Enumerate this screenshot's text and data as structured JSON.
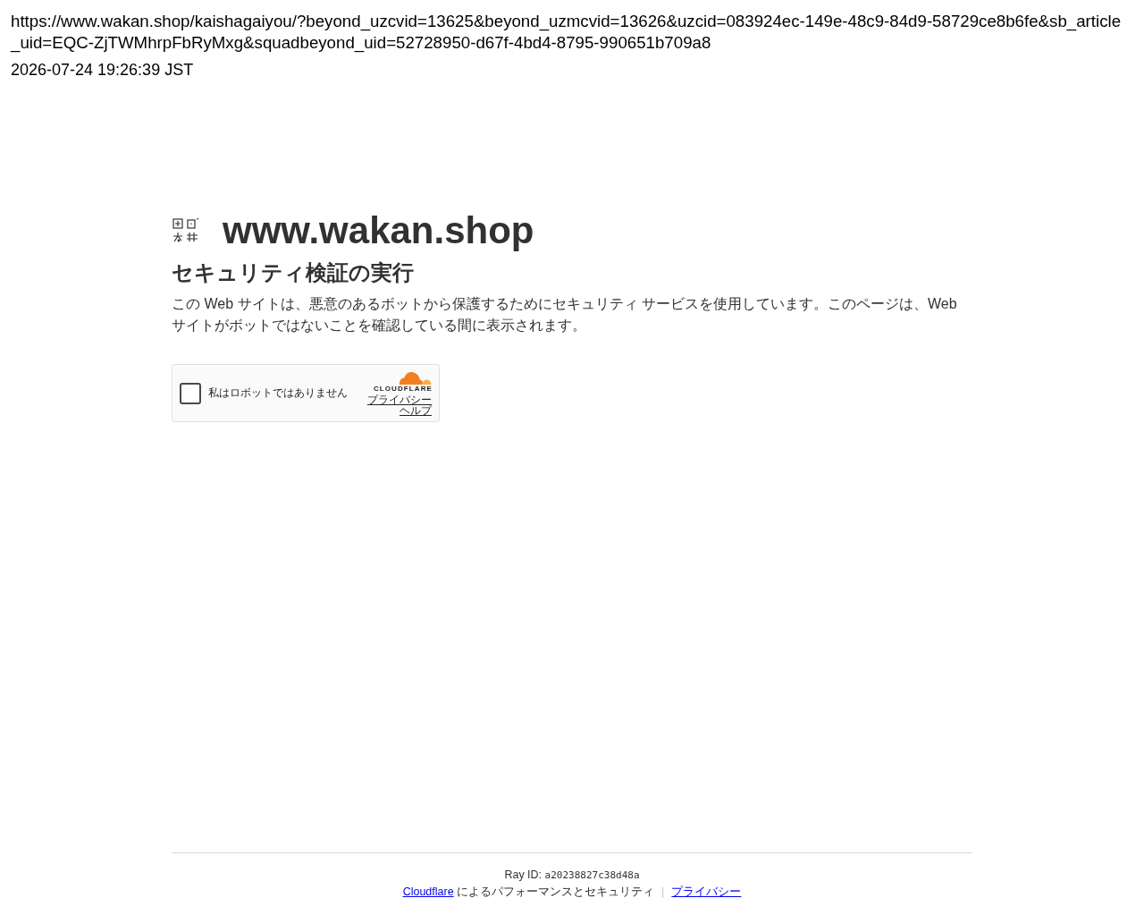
{
  "header": {
    "url": "https://www.wakan.shop/kaishagaiyou/?beyond_uzcvid=13625&beyond_uzmcvid=13626&uzcid=083924ec-149e-48c9-84d9-58729ce8b6fe&sb_article_uid=EQC-ZjTWMhrpFbRyMxg&squadbeyond_uid=52728950-d67f-4bd4-8795-990651b709a8",
    "timestamp": "2026-07-24 19:26:39 JST"
  },
  "site": {
    "name": "www.wakan.shop"
  },
  "page": {
    "heading": "セキュリティ検証の実行",
    "description": "この Web サイトは、悪意のあるボットから保護するためにセキュリティ サービスを使用しています。このページは、Web サイトがボットではないことを確認している間に表示されます。"
  },
  "captcha": {
    "checked": false,
    "label": "私はロボットではありません",
    "brand": "CLOUDFLARE",
    "links": [
      "プライバシー",
      "ヘルプ"
    ]
  },
  "footer": {
    "ray_id_label": "Ray ID:",
    "ray_id": "a20238827c38d48a",
    "items": [
      {
        "kind": "link",
        "text": "Cloudflare"
      },
      {
        "kind": "text",
        "text": "によるパフォーマンスとセキュリティ"
      },
      {
        "kind": "separator",
        "text": "|"
      },
      {
        "kind": "link",
        "text": "プライバシー"
      }
    ]
  }
}
